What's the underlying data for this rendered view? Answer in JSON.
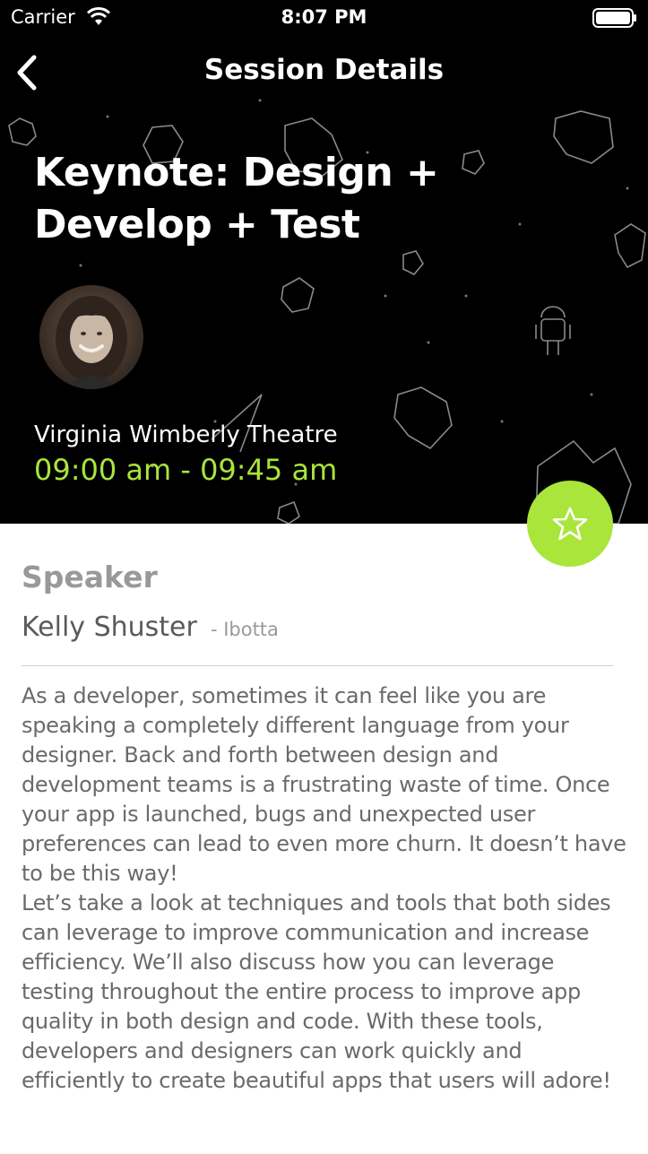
{
  "status_bar": {
    "carrier": "Carrier",
    "time": "8:07 PM"
  },
  "nav": {
    "title": "Session Details"
  },
  "session": {
    "title": "Keynote: Design + Develop + Test",
    "room": "Virginia Wimberly Theatre",
    "time_range": "09:00 am - 09:45 am"
  },
  "speaker_section": {
    "label": "Speaker",
    "name": "Kelly Shuster",
    "company": "- Ibotta"
  },
  "description": "As a developer, sometimes it can feel like you are speaking a completely different language from your designer. Back and forth between design and development teams is a frustrating waste of time. Once your app is launched, bugs and unexpected user preferences can lead to even more churn. It doesn’t have to be this way!\nLet’s take a look at techniques and tools that both sides can leverage to improve communication and increase efficiency. We’ll also discuss how you can leverage testing throughout the entire process to improve app quality in both design and code. With these tools, developers and designers can work quickly and efficiently to create beautiful apps that users will adore!",
  "colors": {
    "accent": "#a9e53b",
    "header_bg": "#000000"
  },
  "icons": {
    "back": "chevron-left-icon",
    "favorite": "star-outline-icon",
    "wifi": "wifi-icon",
    "battery": "battery-icon"
  }
}
